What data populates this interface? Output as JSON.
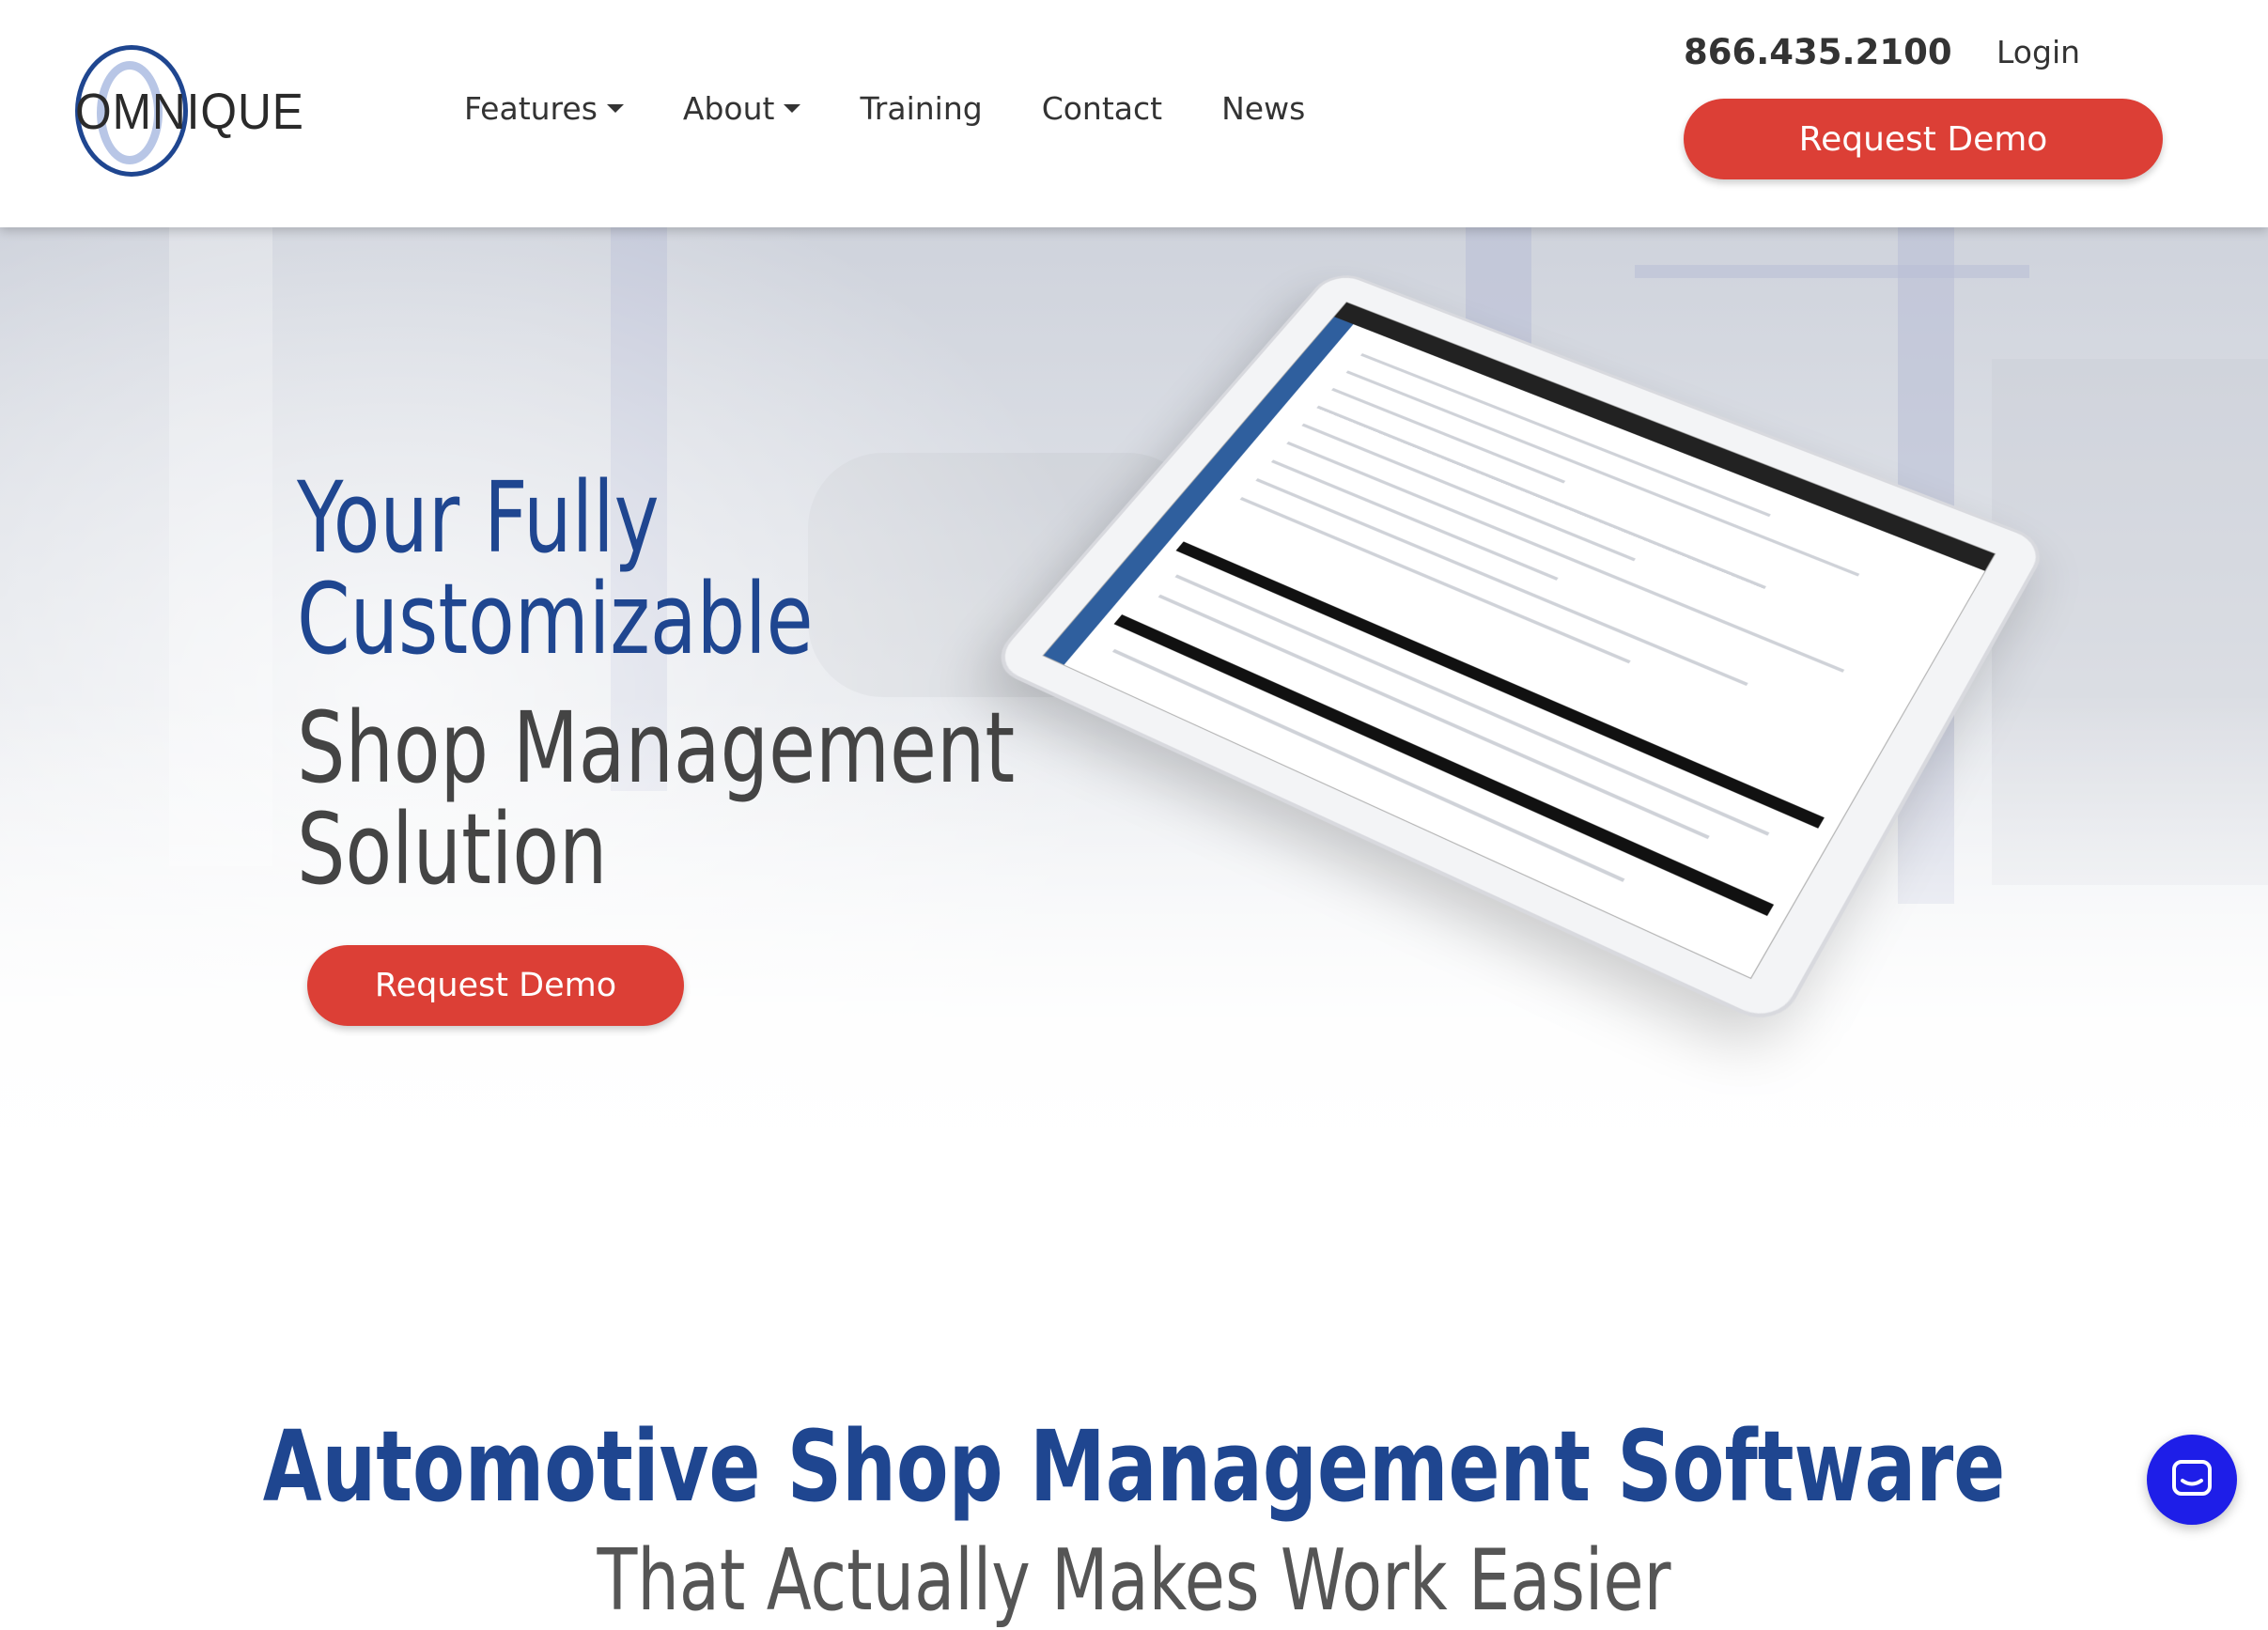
{
  "logo": {
    "text": "OMNIQUE"
  },
  "nav": {
    "items": [
      {
        "label": "Features",
        "dropdown": true
      },
      {
        "label": "About",
        "dropdown": true
      },
      {
        "label": "Training",
        "dropdown": false
      },
      {
        "label": "Contact",
        "dropdown": false
      },
      {
        "label": "News",
        "dropdown": false
      }
    ]
  },
  "header": {
    "phone": "866.435.2100",
    "login": "Login",
    "cta": "Request Demo"
  },
  "hero": {
    "title_line1": "Your Fully",
    "title_line2": "Customizable",
    "sub_line1": "Shop Management",
    "sub_line2": "Solution",
    "cta": "Request Demo"
  },
  "section": {
    "title": "Automotive Shop Management Software",
    "subtitle": "That Actually Makes Work Easier"
  },
  "colors": {
    "brand_blue": "#1f4690",
    "cta_red": "#dc3f36",
    "chat_blue": "#1e1ee8"
  },
  "icons": {
    "chat": "chat-bubble-icon"
  }
}
